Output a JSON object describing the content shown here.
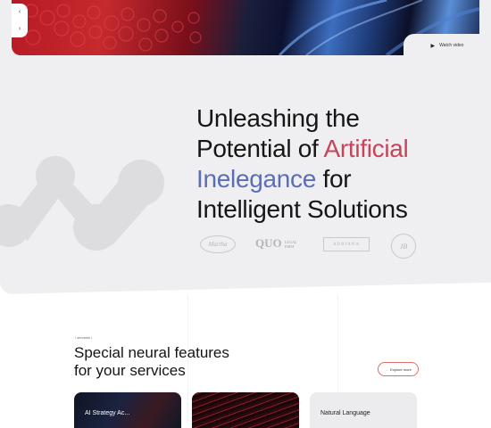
{
  "hero": {
    "watch_video_label": "Watch video",
    "slider_prev": "‹",
    "slider_next": "›",
    "headline_line1": "Unleashing the",
    "headline_line2_start": "Potential of ",
    "headline_line2_accent": "Artificial",
    "headline_line3_accent": "Inelegance",
    "headline_line3_end": " for",
    "headline_line4": "Intelligent Solutions"
  },
  "logos": [
    {
      "name": "Martha",
      "icon": "script-logo"
    },
    {
      "name": "QUO",
      "sub": "LEGAL FIRM",
      "icon": "serif-logo"
    },
    {
      "name": "ADRIANA",
      "icon": "boxed-logo"
    },
    {
      "name": "JB",
      "icon": "round-seal-logo"
    }
  ],
  "services": {
    "eyebrow": "/ services /",
    "title_line1": "Special neural features",
    "title_line2": "for your services",
    "explore_label": "Explore more",
    "cards": [
      {
        "label": "AI Strategy Ac..."
      },
      {
        "label": ""
      },
      {
        "label": "Natural Language"
      }
    ]
  },
  "colors": {
    "accent_red": "#c7445a",
    "accent_blue": "#5b6eb5",
    "hero_bg": "#efeff1"
  }
}
